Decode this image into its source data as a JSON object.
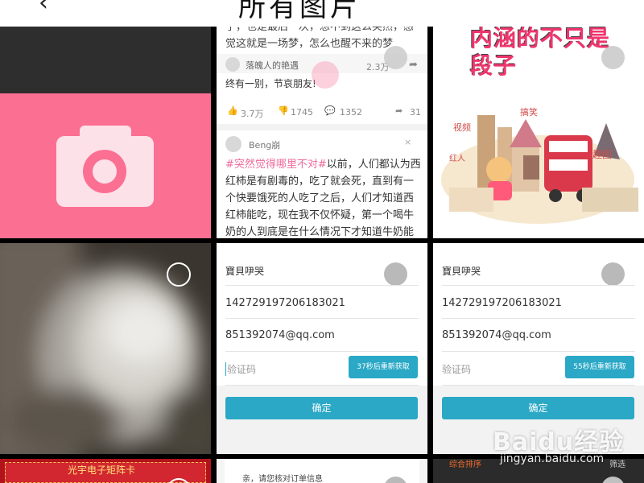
{
  "header": {
    "back_icon": "chevron-left-icon",
    "title": "所有图片"
  },
  "post": {
    "prev_text": "子，也是最后一次，想不到这么突然，感觉这就是一场梦，怎么也醒不来的梦",
    "prev_comment_author": "落魄人的艳遇",
    "prev_comment_likes": "2.3万",
    "prev_comment_text": "终有一别，节哀朋友!",
    "stats": {
      "likes": "3.7万",
      "dislikes": "1745",
      "comments": "1352",
      "shares": "31"
    },
    "author": "Beng崩",
    "close": "×",
    "hashtag": "#突然觉得哪里不对#",
    "body": "以前，人们都认为西红柿是有剧毒的，吃了就会死，直到有一个快要饿死的人吃了之后，人们才知道西红柿能吃，现在我不仅怀疑，第一个喝牛奶的人到底是在什么情况下才知道牛奶能喝的?"
  },
  "comic": {
    "headline": "内涵的不只是段子",
    "tag_video": "视频",
    "tag_joke": "搞笑",
    "tag_red": "红人",
    "tag_fun": "趣图"
  },
  "form": {
    "name": "寶貝吚哭",
    "id_number": "142729197206183021",
    "email": "851392074@qq.com",
    "code_placeholder": "验证码",
    "resend_left": "37秒后重新获取",
    "resend_right": "55秒后重新获取",
    "confirm": "确定"
  },
  "bottom": {
    "banner": "光宇电子矩阵卡",
    "order_prompt": "亲，请您核对订单信息",
    "sort_tab": "综合排序",
    "filter_tab": "筛选"
  },
  "watermark": {
    "brand": "Baidu经验",
    "url": "jingyan.baidu.com"
  }
}
